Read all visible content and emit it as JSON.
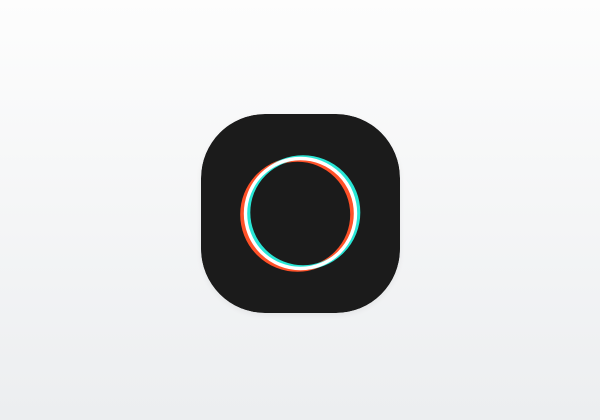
{
  "app_icon": {
    "icon_name": "chromatic-ring-icon",
    "colors": {
      "page_background_top": "#fdfdfd",
      "page_background_bottom": "#eceef0",
      "icon_background": "#1b1b1b",
      "ring_red": "#ff5128",
      "ring_cyan": "#29e6d6",
      "ring_white": "#ffffff"
    }
  }
}
